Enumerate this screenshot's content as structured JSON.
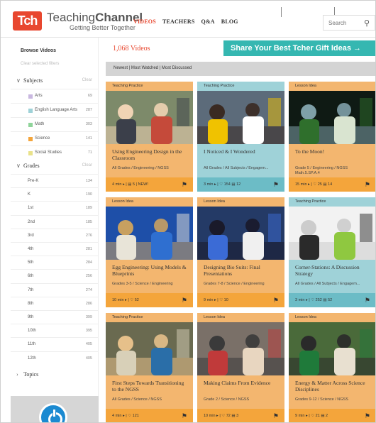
{
  "header": {
    "logo": "Tch",
    "brand_a": "Teaching",
    "brand_b": "Channel",
    "tagline": "Getting Better Together",
    "nav": [
      {
        "label": "VIDEOS"
      },
      {
        "label": "TEACHERS"
      },
      {
        "label": "Q&A"
      },
      {
        "label": "BLOG"
      }
    ],
    "search_placeholder": "Search"
  },
  "sidebar": {
    "heading": "Browse Videos",
    "clear_all": "Clear selected filters",
    "subjects": {
      "label": "Subjects",
      "clear": "Clear",
      "items": [
        {
          "label": "Arts",
          "count": "69",
          "color": "#c9b8e0"
        },
        {
          "label": "English Language Arts",
          "count": "287",
          "color": "#9fd2d8"
        },
        {
          "label": "Math",
          "count": "303",
          "color": "#8fd49a"
        },
        {
          "label": "Science",
          "count": "141",
          "color": "#f4a53b"
        },
        {
          "label": "Social Studies",
          "count": "71",
          "color": "#e9e28a"
        }
      ]
    },
    "grades": {
      "label": "Grades",
      "clear": "Clear",
      "items": [
        {
          "label": "Pre-K",
          "count": "134"
        },
        {
          "label": "K",
          "count": "190"
        },
        {
          "label": "1st",
          "count": "189"
        },
        {
          "label": "2nd",
          "count": "185"
        },
        {
          "label": "3rd",
          "count": "276"
        },
        {
          "label": "4th",
          "count": "281"
        },
        {
          "label": "5th",
          "count": "284"
        },
        {
          "label": "6th",
          "count": "256"
        },
        {
          "label": "7th",
          "count": "274"
        },
        {
          "label": "8th",
          "count": "286"
        },
        {
          "label": "9th",
          "count": "399"
        },
        {
          "label": "10th",
          "count": "395"
        },
        {
          "label": "11th",
          "count": "405"
        },
        {
          "label": "12th",
          "count": "405"
        }
      ]
    },
    "topics": {
      "label": "Topics"
    }
  },
  "main": {
    "count": "1,068 Videos",
    "banner": "Share Your Best Tcher Gift Ideas →",
    "sort": "Newest  |  Most Watched  |  Most Discussed"
  },
  "cards": [
    {
      "tag": "Teaching Practice",
      "title": "Using Engineering Design in the Classroom",
      "meta": "All Grades / Engineering / NGSS",
      "stats": "4 min ▸ | ▤ 5 | NEW!",
      "scheme": "or"
    },
    {
      "tag": "Teaching Practice",
      "title": "I Noticed & I Wondered",
      "meta": "All Grades / All Subjects / Engagem...",
      "stats": "3 min ▸ | ♡ 154 ▤ 12",
      "scheme": "bl"
    },
    {
      "tag": "Lesson Idea",
      "title": "To the Moon!",
      "meta": "Grade 5 / Engineering / NGSS\nMath.5.SP.A.4",
      "stats": "15 min ▸ | ♡ 25 ▤ 14",
      "scheme": "or"
    },
    {
      "tag": "Lesson Idea",
      "title": "Egg Engineering: Using Models & Blueprints",
      "meta": "Grades 3-5 / Science / Engineering",
      "stats": "10 min ▸ | ♡ 52",
      "scheme": "or"
    },
    {
      "tag": "Lesson Idea",
      "title": "Designing Bio Suits: Final Presentations",
      "meta": "Grades 7-8 / Science / Engineering",
      "stats": "9 min ▸ | ♡ 10",
      "scheme": "or"
    },
    {
      "tag": "Teaching Practice",
      "title": "Corner-Stations: A Discussion Strategy",
      "meta": "All Grades / All Subjects / Engagem...",
      "stats": "3 min ▸ | ♡ 252 ▤ 52",
      "scheme": "bl"
    },
    {
      "tag": "Teaching Practice",
      "title": "First Steps Towards Transitioning to the NGSS",
      "meta": "All Grades / Science / NGSS",
      "stats": "4 min ▸ | ♡ 121",
      "scheme": "or"
    },
    {
      "tag": "Lesson Idea",
      "title": "Making Claims From Evidence",
      "meta": "Grade 2 / Science / NGSS",
      "stats": "10 min ▸ | ♡ 72 ▤ 3",
      "scheme": "or"
    },
    {
      "tag": "Lesson Idea",
      "title": "Energy & Matter Across Science Disciplines",
      "meta": "Grades 9-12 / Science / NGSS",
      "stats": "9 min ▸ | ♡ 21 ▤ 2",
      "scheme": "or"
    }
  ],
  "card_images": [
    {
      "name": "thumb-engineering-design",
      "bg": "#7d8a6a",
      "a": "#3b3f4a",
      "b": "#c54a3a",
      "c": "#f0d3b4"
    },
    {
      "name": "thumb-noticed-wondered",
      "bg": "#5c6b7a",
      "a": "#f0c200",
      "b": "#ffffff",
      "c": "#3a2a22"
    },
    {
      "name": "thumb-to-the-moon",
      "bg": "#0f1a14",
      "a": "#2f6f2c",
      "b": "#d9e4d0",
      "c": "#7fa0a8"
    },
    {
      "name": "thumb-egg-engineering",
      "bg": "#1e4fa8",
      "a": "#e8e4d8",
      "b": "#2f6fd0",
      "c": "#c8a060"
    },
    {
      "name": "thumb-bio-suits",
      "bg": "#243a66",
      "a": "#3b6bd6",
      "b": "#f0f0f0",
      "c": "#1a1a2a"
    },
    {
      "name": "thumb-corner-stations",
      "bg": "#f2f2f2",
      "a": "#2a2a2a",
      "b": "#8fc840",
      "c": "#cccccc"
    },
    {
      "name": "thumb-first-steps-ngss",
      "bg": "#6a6a50",
      "a": "#d8d0b8",
      "b": "#2a6ea8",
      "c": "#e6c08a"
    },
    {
      "name": "thumb-making-claims",
      "bg": "#7a7068",
      "a": "#c03a3a",
      "b": "#e8d6c0",
      "c": "#3a3a3a"
    },
    {
      "name": "thumb-energy-matter",
      "bg": "#4a6a3a",
      "a": "#1f7a3a",
      "b": "#e8e0d0",
      "c": "#2a2a2a"
    }
  ]
}
